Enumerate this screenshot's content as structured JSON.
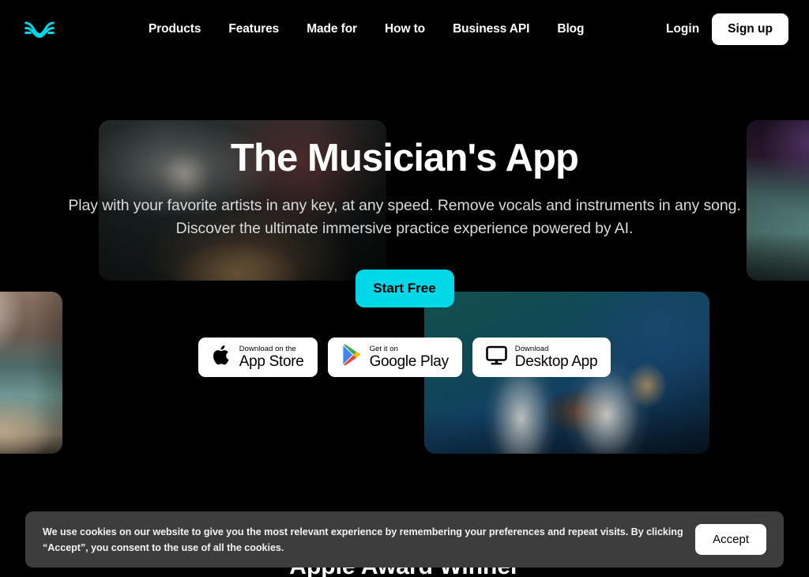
{
  "brand": {
    "logo_icon": "moises-wave-logo-icon",
    "accent_color": "#00D8E8",
    "background_color": "#000000"
  },
  "nav": {
    "links": [
      {
        "label": "Products"
      },
      {
        "label": "Features"
      },
      {
        "label": "Made for"
      },
      {
        "label": "How to"
      },
      {
        "label": "Business API"
      },
      {
        "label": "Blog"
      }
    ],
    "login_label": "Login",
    "signup_label": "Sign up"
  },
  "hero": {
    "title": "The Musician's App",
    "subtitle_line1": "Play with your favorite artists in any key, at any speed. Remove vocals and instruments in any song.",
    "subtitle_line2": "Discover the ultimate immersive practice experience powered by AI.",
    "cta_label": "Start Free"
  },
  "stores": [
    {
      "icon": "apple-icon",
      "small_label": "Download on the",
      "big_label": "App Store"
    },
    {
      "icon": "google-play-icon",
      "small_label": "Get it on",
      "big_label": "Google Play"
    },
    {
      "icon": "desktop-monitor-icon",
      "small_label": "Download",
      "big_label": "Desktop App"
    }
  ],
  "collage": {
    "tiles": [
      {
        "name": "drummer-photo"
      },
      {
        "name": "studio-photo"
      },
      {
        "name": "left-edge-photo"
      },
      {
        "name": "guitar-duo-photo"
      }
    ]
  },
  "next_section": {
    "heading": "Apple Award Winner"
  },
  "cookie": {
    "message": "We use cookies on our website to give you the most relevant experience by remembering your preferences and repeat visits. By clicking “Accept”, you consent to the use of all the cookies.",
    "accept_label": "Accept"
  }
}
